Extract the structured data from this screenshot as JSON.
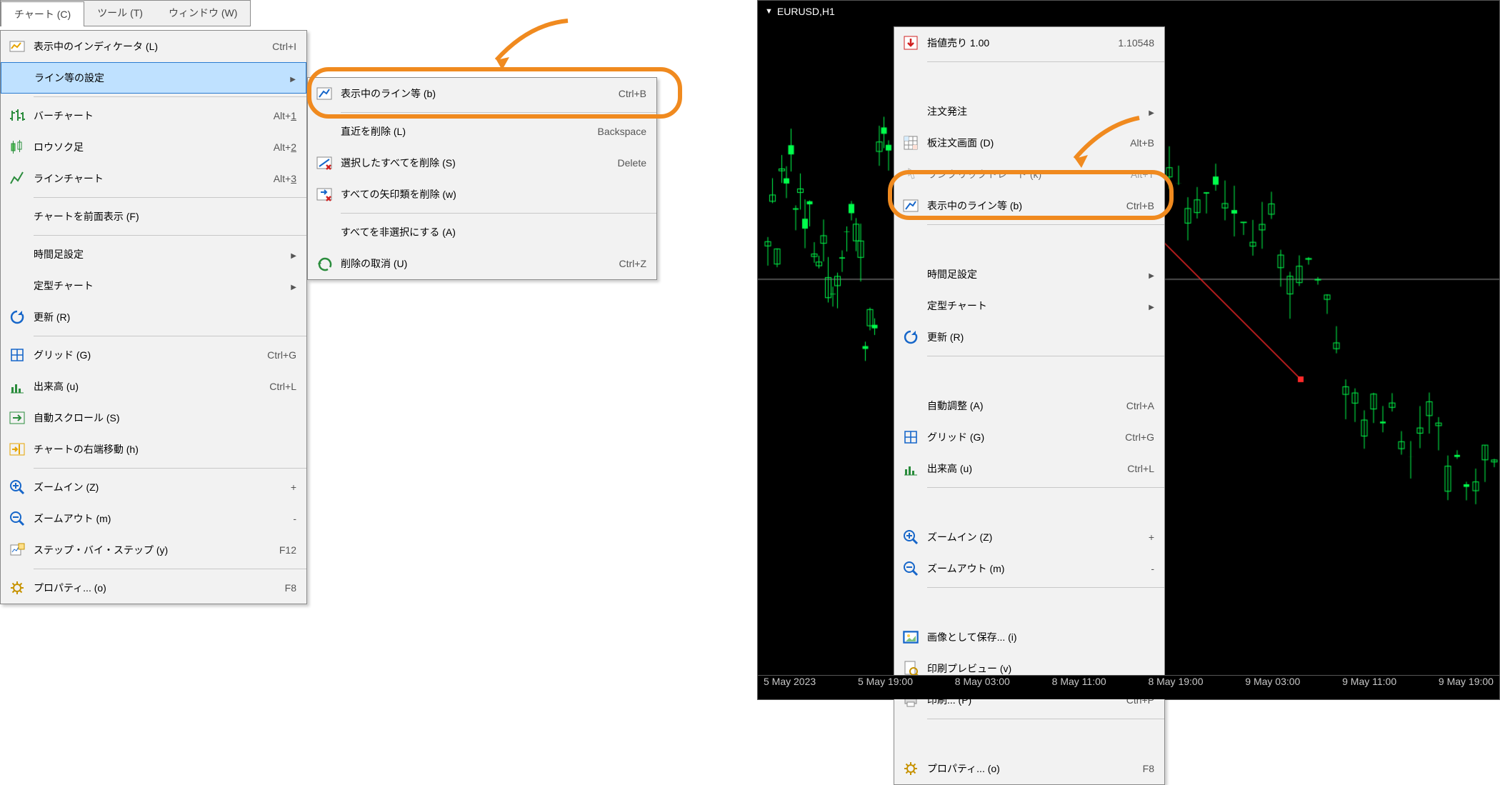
{
  "menubar": {
    "chart": "チャート (C)",
    "tools": "ツール (T)",
    "window": "ウィンドウ (W)"
  },
  "chartmenu": [
    {
      "id": "indicators",
      "label": "表示中のインディケータ (L)",
      "shortcut": "Ctrl+I",
      "icon": "indicator-icon"
    },
    {
      "id": "objects",
      "label": "ライン等の設定",
      "shortcut": "",
      "icon": "",
      "highlight": true,
      "submenu": true
    },
    {
      "sep": true
    },
    {
      "id": "bar",
      "label": "バーチャート",
      "shortcut": "Alt+1",
      "icon": "barchart-icon",
      "u": "1"
    },
    {
      "id": "candle",
      "label": "ロウソク足",
      "shortcut": "Alt+2",
      "icon": "candle-icon",
      "u": "2"
    },
    {
      "id": "line",
      "label": "ラインチャート",
      "shortcut": "Alt+3",
      "icon": "linechart-icon",
      "u": "3"
    },
    {
      "sep": true
    },
    {
      "id": "foreground",
      "label": "チャートを前面表示 (F)",
      "shortcut": "",
      "icon": ""
    },
    {
      "sep": true
    },
    {
      "id": "timeframe",
      "label": "時間足設定",
      "shortcut": "",
      "icon": "",
      "submenu": true
    },
    {
      "id": "template",
      "label": "定型チャート",
      "shortcut": "",
      "icon": "",
      "submenu": true
    },
    {
      "id": "refresh",
      "label": "更新 (R)",
      "shortcut": "",
      "icon": "refresh-icon"
    },
    {
      "sep": true
    },
    {
      "id": "grid",
      "label": "グリッド (G)",
      "shortcut": "Ctrl+G",
      "icon": "grid-icon"
    },
    {
      "id": "volumes",
      "label": "出来高 (u)",
      "shortcut": "Ctrl+L",
      "icon": "volumes-icon"
    },
    {
      "id": "autoscroll",
      "label": "自動スクロール (S)",
      "shortcut": "",
      "icon": "autoscroll-icon"
    },
    {
      "id": "shift",
      "label": "チャートの右端移動 (h)",
      "shortcut": "",
      "icon": "shift-icon"
    },
    {
      "sep": true
    },
    {
      "id": "zoomin",
      "label": "ズームイン (Z)",
      "shortcut": "+",
      "icon": "zoomin-icon"
    },
    {
      "id": "zoomout",
      "label": "ズームアウト (m)",
      "shortcut": "-",
      "icon": "zoomout-icon"
    },
    {
      "id": "step",
      "label": "ステップ・バイ・ステップ (y)",
      "shortcut": "F12",
      "icon": "step-icon"
    },
    {
      "sep": true
    },
    {
      "id": "props",
      "label": "プロパティ... (o)",
      "shortcut": "F8",
      "icon": "props-icon"
    }
  ],
  "submenu1": [
    {
      "id": "objlist",
      "label": "表示中のライン等 (b)",
      "shortcut": "Ctrl+B",
      "icon": "objlist-icon"
    },
    {
      "sep": true
    },
    {
      "id": "dellast",
      "label": "直近を削除 (L)",
      "shortcut": "Backspace",
      "icon": ""
    },
    {
      "id": "delsel",
      "label": "選択したすべてを削除 (S)",
      "shortcut": "Delete",
      "icon": "delsel-icon"
    },
    {
      "id": "delarrows",
      "label": "すべての矢印類を削除 (w)",
      "shortcut": "",
      "icon": "delarrows-icon"
    },
    {
      "sep": true
    },
    {
      "id": "unselect",
      "label": "すべてを非選択にする (A)",
      "shortcut": "",
      "icon": ""
    },
    {
      "id": "undo",
      "label": "削除の取消 (U)",
      "shortcut": "Ctrl+Z",
      "icon": "undo-icon"
    }
  ],
  "chart": {
    "title": "EURUSD,H1",
    "timeaxis": [
      "5 May 2023",
      "5 May 19:00",
      "8 May 03:00",
      "8 May 11:00",
      "8 May 19:00",
      "9 May 03:00",
      "9 May 11:00",
      "9 May 19:00"
    ]
  },
  "ctxmenu": [
    {
      "id": "selllimit",
      "label": "指値売り 1.00",
      "shortcut": "1.10548",
      "icon": "sell-icon"
    },
    {
      "sep": true
    },
    {
      "id": "neworder",
      "label": "注文発注",
      "shortcut": "",
      "icon": "",
      "submenu": true
    },
    {
      "id": "dom",
      "label": "板注文画面 (D)",
      "shortcut": "Alt+B",
      "icon": "dom-icon"
    },
    {
      "id": "oneclick",
      "label": "ワンクリックトレード (k)",
      "shortcut": "Alt+T",
      "icon": "oneclick-icon",
      "faded": true
    },
    {
      "id": "objlist2",
      "label": "表示中のライン等 (b)",
      "shortcut": "Ctrl+B",
      "icon": "objlist-icon",
      "marked": true
    },
    {
      "sep": true
    },
    {
      "id": "timeframe2",
      "label": "時間足設定",
      "shortcut": "",
      "icon": "",
      "submenu": true
    },
    {
      "id": "template2",
      "label": "定型チャート",
      "shortcut": "",
      "icon": "",
      "submenu": true
    },
    {
      "id": "refresh2",
      "label": "更新 (R)",
      "shortcut": "",
      "icon": "refresh-icon"
    },
    {
      "sep": true
    },
    {
      "id": "autoscale",
      "label": "自動調整 (A)",
      "shortcut": "Ctrl+A",
      "icon": ""
    },
    {
      "id": "grid2",
      "label": "グリッド (G)",
      "shortcut": "Ctrl+G",
      "icon": "grid-icon"
    },
    {
      "id": "volumes2",
      "label": "出来高 (u)",
      "shortcut": "Ctrl+L",
      "icon": "volumes-icon"
    },
    {
      "sep": true
    },
    {
      "id": "zoomin2",
      "label": "ズームイン (Z)",
      "shortcut": "+",
      "icon": "zoomin-icon"
    },
    {
      "id": "zoomout2",
      "label": "ズームアウト (m)",
      "shortcut": "-",
      "icon": "zoomout-icon"
    },
    {
      "sep": true
    },
    {
      "id": "saveimg",
      "label": "画像として保存... (i)",
      "shortcut": "",
      "icon": "saveimg-icon"
    },
    {
      "id": "printprev",
      "label": "印刷プレビュー (v)",
      "shortcut": "",
      "icon": "printprev-icon"
    },
    {
      "id": "print",
      "label": "印刷... (P)",
      "shortcut": "Ctrl+P",
      "icon": "print-icon"
    },
    {
      "sep": true
    },
    {
      "id": "props2",
      "label": "プロパティ... (o)",
      "shortcut": "F8",
      "icon": "props-icon"
    }
  ],
  "colors": {
    "accent": "#f08a1f",
    "candleUp": "#00ff4c",
    "gridline": "#4a4a4a"
  }
}
